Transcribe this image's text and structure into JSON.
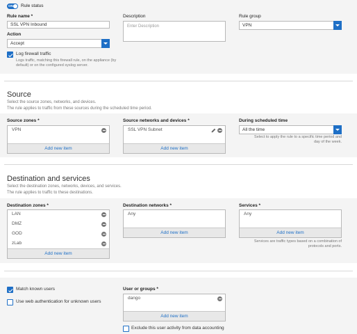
{
  "rule_status": {
    "toggle_label": "ON",
    "label": "Rule status"
  },
  "rule_name": {
    "label": "Rule name *",
    "value": "SSL VPN Inbound"
  },
  "description": {
    "label": "Description",
    "placeholder": "Enter Description"
  },
  "rule_group": {
    "label": "Rule group",
    "value": "VPN"
  },
  "action": {
    "label": "Action",
    "value": "Accept"
  },
  "log_traffic": {
    "label": "Log firewall traffic",
    "checked": true,
    "hint_line1": "Logs traffic, matching this firewall rule, on the appliance (by",
    "hint_line2": "default) or on the configured syslog server."
  },
  "source": {
    "title": "Source",
    "sub1": "Select the source zones, networks, and devices.",
    "sub2": "The rule applies to traffic from these sources during the scheduled time period.",
    "zones": {
      "label": "Source zones *",
      "items": [
        "VPN"
      ],
      "add": "Add new item"
    },
    "networks": {
      "label": "Source networks and devices *",
      "items": [
        "SSL VPN Subnet"
      ],
      "add": "Add new item"
    },
    "schedule": {
      "label": "During scheduled time",
      "value": "All the time",
      "hint_line1": "Select to apply the rule to a specific time period and",
      "hint_line2": "day of the week."
    }
  },
  "destination": {
    "title": "Destination and services",
    "sub1": "Select the destination zones, networks, devices, and services.",
    "sub2": "The rule applies to traffic to these destinations.",
    "zones": {
      "label": "Destination zones *",
      "items": [
        "LAN",
        "DMZ",
        "GOD",
        "zLab"
      ],
      "add": "Add new item"
    },
    "networks": {
      "label": "Destination networks *",
      "items": [
        "Any"
      ],
      "add": "Add new item"
    },
    "services": {
      "label": "Services *",
      "items": [
        "Any"
      ],
      "add": "Add new item",
      "hint_line1": "Services are traffic types based on a combination of",
      "hint_line2": "protocols and ports."
    }
  },
  "identity": {
    "match_known_users": {
      "label": "Match known users",
      "checked": true
    },
    "web_auth": {
      "label": "Use web authentication for unknown users",
      "checked": false
    },
    "users": {
      "label": "User or groups *",
      "items": [
        "dango"
      ],
      "add": "Add new item"
    },
    "exclude": {
      "label": "Exclude this user activity from data accounting",
      "checked": false
    }
  },
  "colors": {
    "accent": "#1e6fc6",
    "band": "#f4f4f4",
    "border": "#b8b8b8"
  }
}
